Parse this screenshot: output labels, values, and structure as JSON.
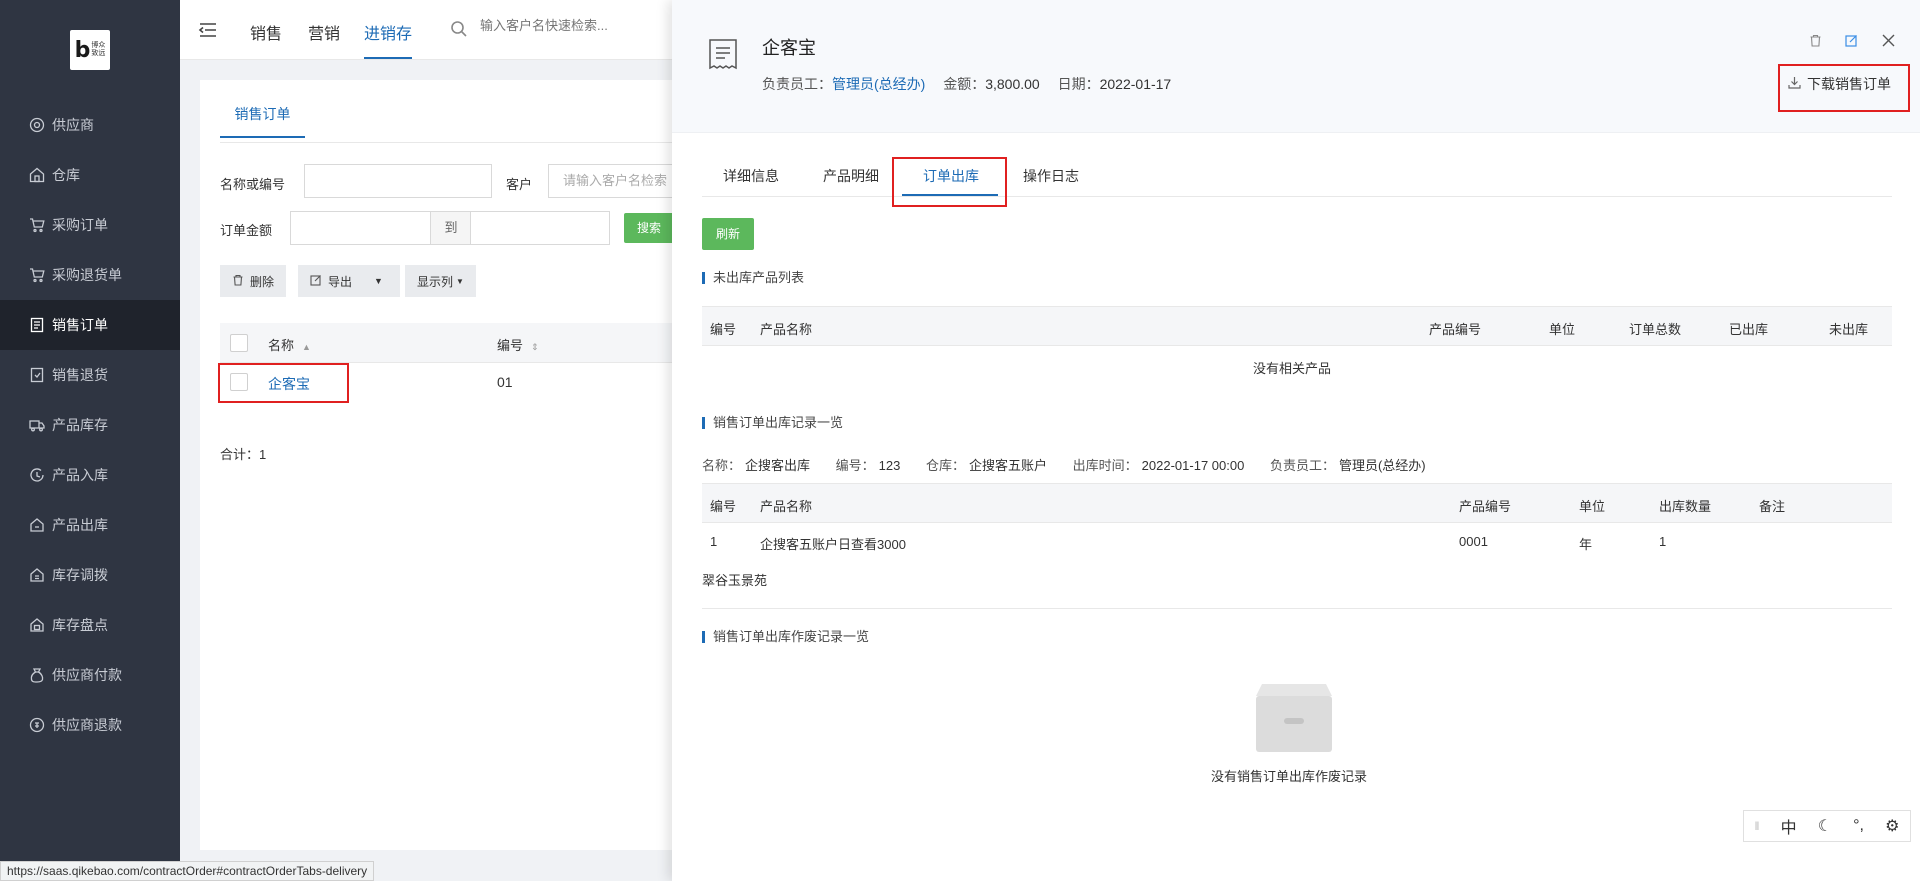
{
  "logo": {
    "letter": "b",
    "text1": "博众",
    "text2": "致远"
  },
  "sidebar": {
    "items": [
      {
        "label": "供应商",
        "icon": "supplier-icon"
      },
      {
        "label": "仓库",
        "icon": "warehouse-icon"
      },
      {
        "label": "采购订单",
        "icon": "cart-icon"
      },
      {
        "label": "采购退货单",
        "icon": "cart-return-icon"
      },
      {
        "label": "销售订单",
        "icon": "document-icon",
        "active": true
      },
      {
        "label": "销售退货",
        "icon": "return-doc-icon"
      },
      {
        "label": "产品库存",
        "icon": "truck-icon"
      },
      {
        "label": "产品入库",
        "icon": "inbound-icon"
      },
      {
        "label": "产品出库",
        "icon": "outbound-icon"
      },
      {
        "label": "库存调拨",
        "icon": "transfer-icon"
      },
      {
        "label": "库存盘点",
        "icon": "inventory-icon"
      },
      {
        "label": "供应商付款",
        "icon": "money-bag-icon"
      },
      {
        "label": "供应商退款",
        "icon": "refund-icon"
      }
    ]
  },
  "topbar": {
    "tabs": [
      "销售",
      "营销",
      "进销存"
    ],
    "active_tab": "进销存",
    "search_placeholder": "输入客户名快速检索..."
  },
  "main": {
    "tab": "销售订单",
    "filters": {
      "name_label": "名称或编号",
      "customer_label": "客户",
      "customer_placeholder": "请输入客户名检索",
      "amount_label": "订单金额",
      "to": "到",
      "search": "搜索"
    },
    "toolbar": {
      "delete": "删除",
      "export": "导出",
      "columns": "显示列"
    },
    "table": {
      "headers": [
        "名称",
        "编号"
      ],
      "rows": [
        {
          "name": "企客宝",
          "code": "01"
        }
      ]
    },
    "total": "合计：1"
  },
  "drawer": {
    "title": "企客宝",
    "owner_label": "负责员工：",
    "owner": "管理员(总经办)",
    "amount_label": "金额：",
    "amount": "3,800.00",
    "date_label": "日期：",
    "date": "2022-01-17",
    "download": "下载销售订单",
    "tabs": [
      "详细信息",
      "产品明细",
      "订单出库",
      "操作日志"
    ],
    "active_tab": "订单出库",
    "refresh": "刷新",
    "section1": "未出库产品列表",
    "table1_headers": [
      "编号",
      "产品名称",
      "产品编号",
      "单位",
      "订单总数",
      "已出库",
      "未出库"
    ],
    "table1_empty": "没有相关产品",
    "section2": "销售订单出库记录一览",
    "record": {
      "name_label": "名称：",
      "name": "企搜客出库",
      "code_label": "编号：",
      "code": "123",
      "warehouse_label": "仓库：",
      "warehouse": "企搜客五账户",
      "time_label": "出库时间：",
      "time": "2022-01-17 00:00",
      "owner_label": "负责员工：",
      "owner": "管理员(总经办)"
    },
    "table2_headers": [
      "编号",
      "产品名称",
      "产品编号",
      "单位",
      "出库数量",
      "备注"
    ],
    "table2_rows": [
      {
        "no": "1",
        "name": "企搜客五账户日查看3000",
        "code": "0001",
        "unit": "年",
        "qty": "1",
        "note": ""
      }
    ],
    "remark": "翠谷玉景苑",
    "section3": "销售订单出库作废记录一览",
    "empty3": "没有销售订单出库作废记录"
  },
  "ime": {
    "lang": "中"
  },
  "statusbar": "https://saas.qikebao.com/contractOrder#contractOrderTabs-delivery",
  "colors": {
    "accent": "#1d6bb5",
    "green": "#5cb85c",
    "sidebar": "#2f3542",
    "highlight": "#e02020"
  }
}
